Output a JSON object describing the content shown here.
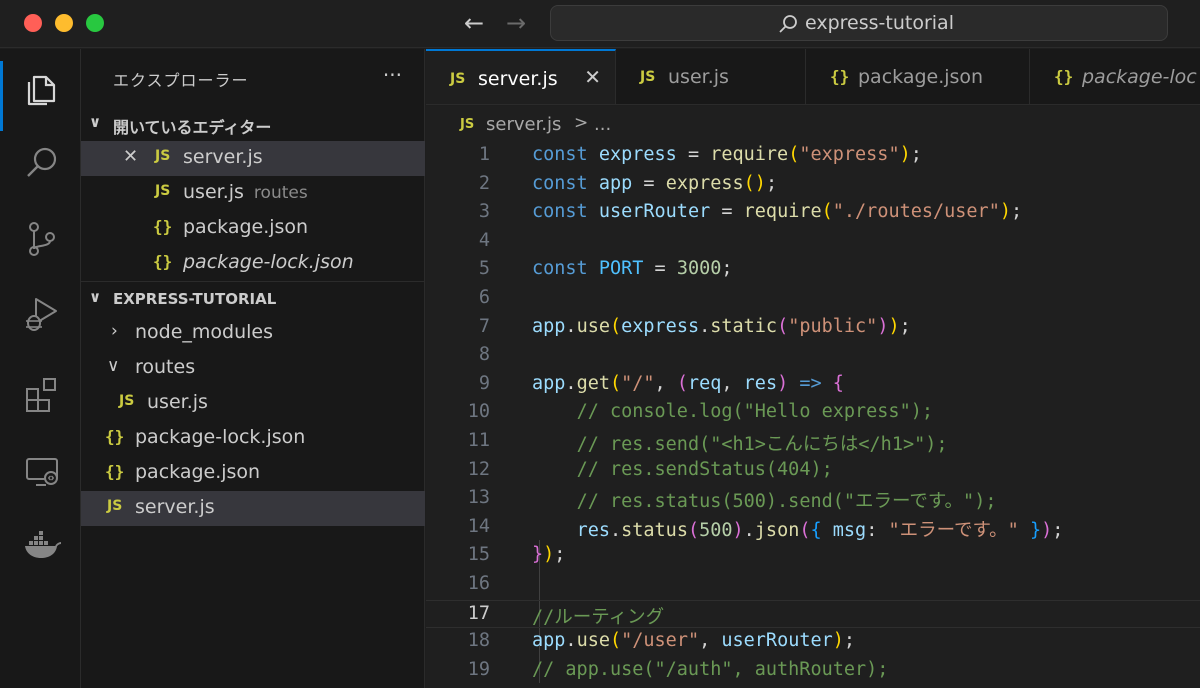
{
  "titlebar": {
    "search_text": "express-tutorial",
    "back_icon": "arrow-left-icon",
    "forward_icon": "arrow-right-icon"
  },
  "activity_bar": {
    "items": [
      "explorer-icon",
      "search-icon",
      "source-control-icon",
      "run-debug-icon",
      "extensions-icon",
      "remote-explorer-icon",
      "docker-icon"
    ]
  },
  "sidebar": {
    "title": "エクスプローラー",
    "more": "···",
    "open_editors": {
      "header": "開いているエディター",
      "items": [
        {
          "icon": "JS",
          "name": "server.js",
          "desc": ""
        },
        {
          "icon": "JS",
          "name": "user.js",
          "desc": "routes"
        },
        {
          "icon": "{}",
          "name": "package.json",
          "desc": ""
        },
        {
          "icon": "{}",
          "name": "package-lock.json",
          "desc": ""
        }
      ]
    },
    "project": {
      "header": "EXPRESS-TUTORIAL",
      "items": [
        {
          "icon": ">",
          "name": "node_modules"
        },
        {
          "icon": "v",
          "name": "routes"
        },
        {
          "icon": "JS",
          "name": "user.js"
        },
        {
          "icon": "{}",
          "name": "package-lock.json"
        },
        {
          "icon": "{}",
          "name": "package.json"
        },
        {
          "icon": "JS",
          "name": "server.js"
        }
      ]
    }
  },
  "tabs": [
    {
      "icon": "JS",
      "label": "server.js",
      "close": "✕"
    },
    {
      "icon": "JS",
      "label": "user.js"
    },
    {
      "icon": "{}",
      "label": "package.json"
    },
    {
      "icon": "{}",
      "label": "package-loc"
    }
  ],
  "breadcrumb": {
    "icon": "JS",
    "file": "server.js",
    "separator": ">",
    "more": "..."
  },
  "code": {
    "current_line": 17,
    "lines": [
      "const express = require(\"express\");",
      "const app = express();",
      "const userRouter = require(\"./routes/user\");",
      "",
      "const PORT = 3000;",
      "",
      "app.use(express.static(\"public\"));",
      "",
      "app.get(\"/\", (req, res) => {",
      "    // console.log(\"Hello express\");",
      "    // res.send(\"<h1>こんにちは</h1>\");",
      "    // res.sendStatus(404);",
      "    // res.status(500).send(\"エラーです。\");",
      "    res.status(500).json({ msg: \"エラーです。\" });",
      "});",
      "",
      "//ルーティング",
      "app.use(\"/user\", userRouter);",
      "// app.use(\"/auth\", authRouter);"
    ],
    "line_numbers": [
      "1",
      "2",
      "3",
      "4",
      "5",
      "6",
      "7",
      "8",
      "9",
      "10",
      "11",
      "12",
      "13",
      "14",
      "15",
      "16",
      "17",
      "18",
      "19"
    ]
  },
  "colors": {
    "accent": "#0078d4",
    "js_icon": "#cbcb41",
    "keyword": "#569cd6",
    "string": "#ce9178",
    "comment": "#6a9955"
  }
}
